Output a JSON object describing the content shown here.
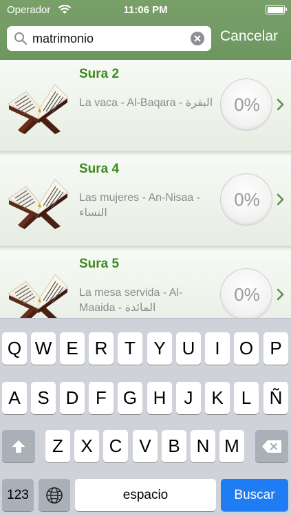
{
  "status_bar": {
    "carrier": "Operador",
    "time": "11:06 PM"
  },
  "search": {
    "value": "matrimonio",
    "cancel_label": "Cancelar"
  },
  "results": [
    {
      "title": "Sura 2",
      "subtitle": "La vaca  - Al-Baqara - البقرة",
      "progress": "0%"
    },
    {
      "title": "Sura 4",
      "subtitle": "Las mujeres  - An-Nisaa - النساء",
      "progress": "0%"
    },
    {
      "title": "Sura 5",
      "subtitle": "La mesa servida  - Al-Maaida - المائدة",
      "progress": "0%"
    }
  ],
  "keyboard": {
    "row1": [
      "Q",
      "W",
      "E",
      "R",
      "T",
      "Y",
      "U",
      "I",
      "O",
      "P"
    ],
    "row2": [
      "A",
      "S",
      "D",
      "F",
      "G",
      "H",
      "J",
      "K",
      "L",
      "Ñ"
    ],
    "row3": [
      "Z",
      "X",
      "C",
      "V",
      "B",
      "N",
      "M"
    ],
    "numbers_label": "123",
    "space_label": "espacio",
    "search_label": "Buscar"
  },
  "colors": {
    "header_green": "#6c9660",
    "title_green": "#3d8a1e",
    "search_key_blue": "#1f7cf2"
  }
}
